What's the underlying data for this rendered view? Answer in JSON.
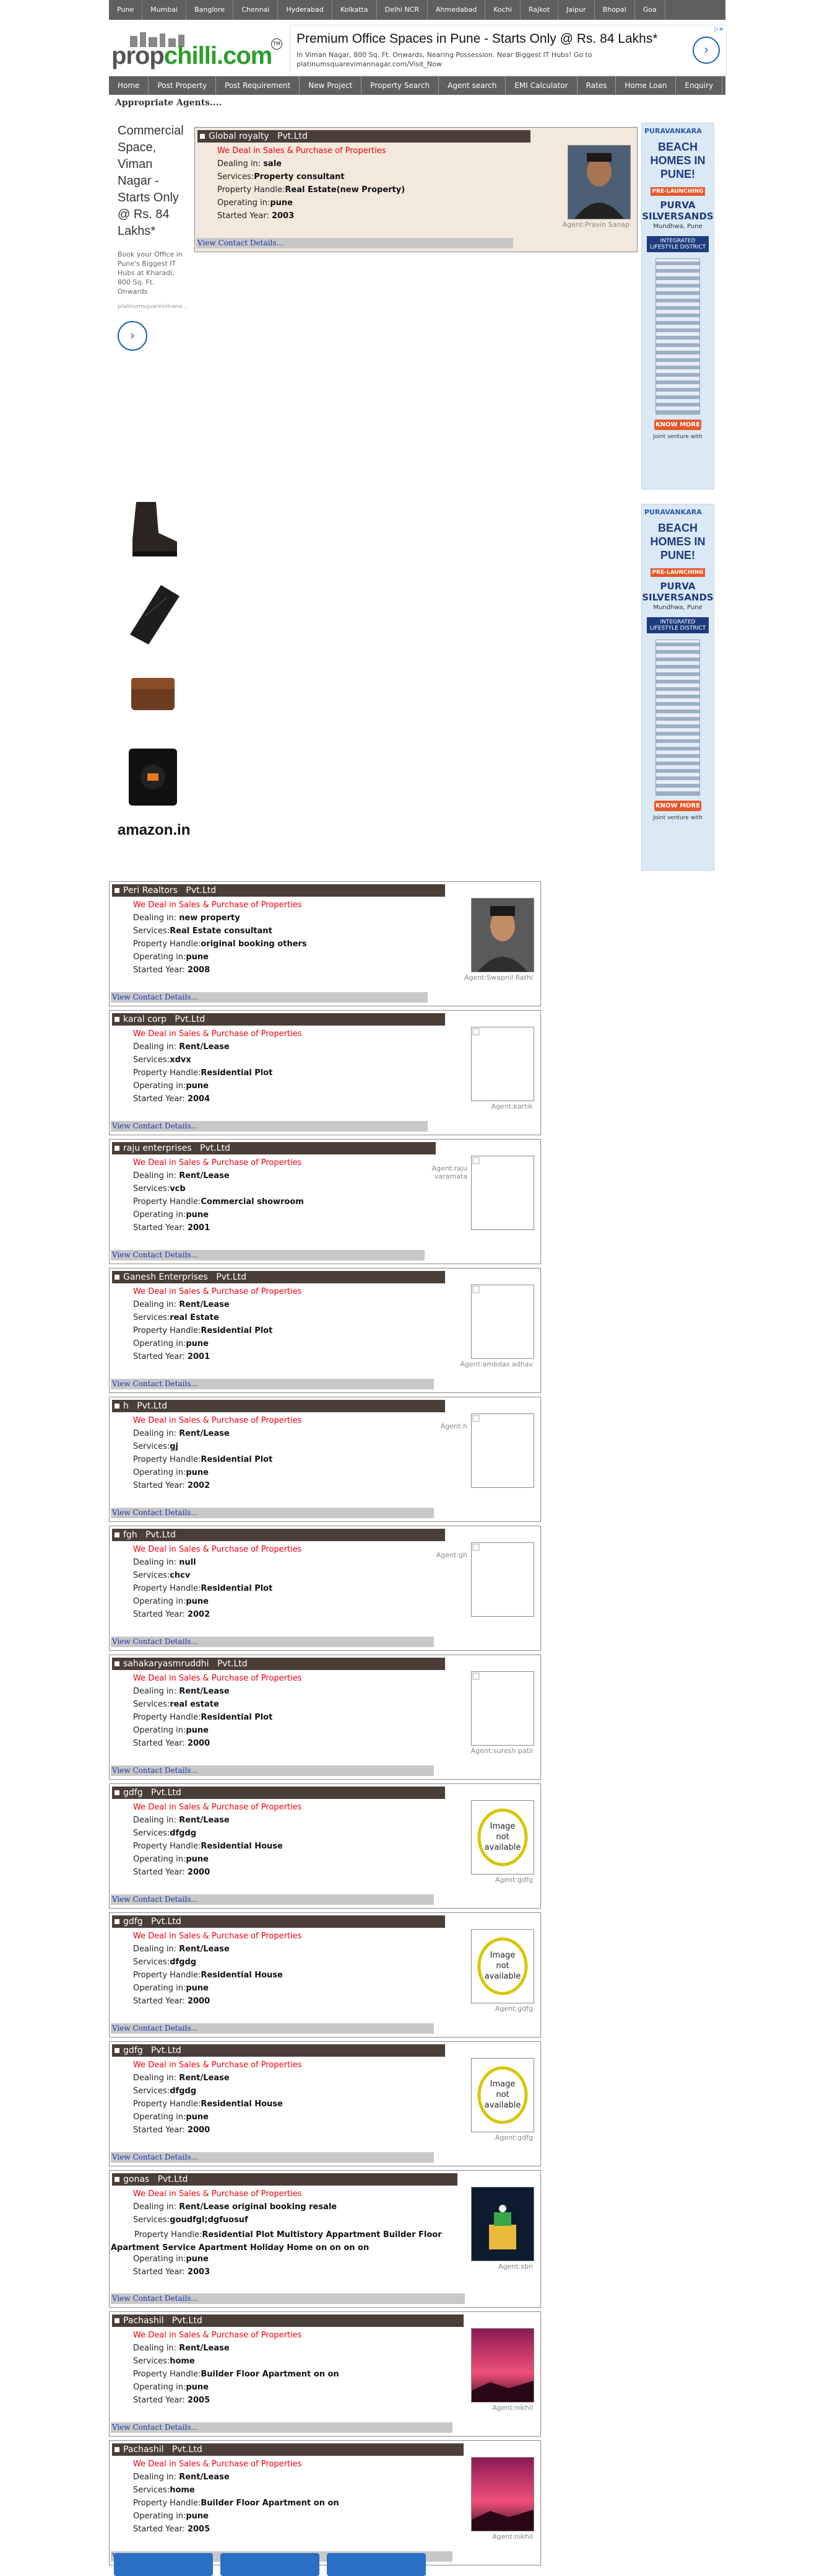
{
  "city_nav": [
    "Pune",
    "Mumbai",
    "Banglore",
    "Chennai",
    "Hyderabad",
    "Kolkatta",
    "Delhi NCR",
    "Ahmedabad",
    "Kochi",
    "Rajkot",
    "Jaipur",
    "Bhopal",
    "Goa"
  ],
  "logo": {
    "part1": "prop",
    "part2": "chilli",
    "part3": ".com",
    "tm": "TM"
  },
  "top_ad": {
    "headline": "Premium Office Spaces in Pune - Starts Only @ Rs. 84 Lakhs*",
    "text": "In Viman Nagar, 800 Sq. Ft. Onwards, Nearing Possession. Near Biggest IT Hubs! Go to",
    "url": "platinumsquarevimannagar.com/Visit_Now",
    "arrow": "›"
  },
  "main_nav": [
    "Home",
    "Post Property",
    "Post Requirement",
    "New Project",
    "Property Search",
    "Agent search",
    "EMI Calculator",
    "Rates",
    "Home Loan",
    "Enquiry"
  ],
  "page_heading": "Appropriate Agents....",
  "left_ad": {
    "big": "Commercial Space, Viman Nagar - Starts Only @ Rs. 84 Lakhs*",
    "small": "Book your Office in Pune's Biggest IT Hubs at Kharadi, 800 Sq. Ft. Onwards",
    "url": "platinumsquarevimana...",
    "arrow": "›"
  },
  "amazon_label": "amazon.in",
  "right_ad": {
    "brand": "PURAVANKARA",
    "headline": "BEACH HOMES IN PUNE!",
    "tag": "PRE-LAUNCHING",
    "project": "PURVA SILVERSANDS",
    "location": "Mundhwa, Pune",
    "sub": "INTEGRATED LIFESTYLE DISTRICT",
    "know": "KNOW MORE",
    "jv": "Joint venture with"
  },
  "labels": {
    "tagline": "We Deal in Sales & Purchase of Properties",
    "dealing": "Dealing in: ",
    "services": "Services:",
    "handle": "Property Handle:",
    "operating": "Operating in:",
    "started": "Started Year: ",
    "view": "View Contact Details...",
    "pvt": "Pvt.Ltd",
    "not_available": "Image not available"
  },
  "agents": [
    {
      "company": "Global royalty",
      "dealing": "sale",
      "services": "Property consultant",
      "handle": "Real Estate(new Property)",
      "operating": "pune",
      "year": "2003",
      "agent": "Agent:Pravin Sanap"
    },
    {
      "company": "Peri Realtors",
      "dealing": "new property",
      "services": "Real Estate consultant",
      "handle": "original booking others",
      "operating": "pune",
      "year": "2008",
      "agent": "Agent:Swapnil Rathi"
    },
    {
      "company": "karal corp",
      "dealing": "Rent/Lease",
      "services": "xdvx",
      "handle": "Residential Plot",
      "operating": "pune",
      "year": "2004",
      "agent": "Agent:kartik"
    },
    {
      "company": "raju enterprises",
      "dealing": "Rent/Lease",
      "services": "vcb",
      "handle": "Commercial showroom",
      "operating": "pune",
      "year": "2001",
      "agent": "Agent:raju varamata"
    },
    {
      "company": "Ganesh Enterprises",
      "dealing": "Rent/Lease",
      "services": "real Estate",
      "handle": "Residential Plot",
      "operating": "pune",
      "year": "2001",
      "agent": "Agent:ambdas adhav"
    },
    {
      "company": "h",
      "dealing": "Rent/Lease",
      "services": "gj",
      "handle": "Residential Plot",
      "operating": "pune",
      "year": "2002",
      "agent": "Agent:h"
    },
    {
      "company": "fgh",
      "dealing": "null",
      "services": "chcv",
      "handle": "Residential Plot",
      "operating": "pune",
      "year": "2002",
      "agent": "Agent:gh"
    },
    {
      "company": "sahakaryasmruddhi",
      "dealing": "Rent/Lease",
      "services": "real estate",
      "handle": "Residential Plot",
      "operating": "pune",
      "year": "2000",
      "agent": "Agent:suresh patil"
    },
    {
      "company": "gdfg",
      "dealing": "Rent/Lease",
      "services": "dfgdg",
      "handle": "Residential House",
      "operating": "pune",
      "year": "2000",
      "agent": "Agent:gdfg"
    },
    {
      "company": "gdfg",
      "dealing": "Rent/Lease",
      "services": "dfgdg",
      "handle": "Residential House",
      "operating": "pune",
      "year": "2000",
      "agent": "Agent:gdfg"
    },
    {
      "company": "gdfg",
      "dealing": "Rent/Lease",
      "services": "dfgdg",
      "handle": "Residential House",
      "operating": "pune",
      "year": "2000",
      "agent": "Agent:gdfg"
    },
    {
      "company": "gonas",
      "dealing": "Rent/Lease original booking resale",
      "services": "goudfgl;dgfuosuf",
      "handle": "Residential Plot Multistory Appartment Builder Floor Apartment Service Apartment Holiday Home on on on on",
      "operating": "pune",
      "year": "2003",
      "agent": "Agent:sbn"
    },
    {
      "company": "Pachashil",
      "dealing": "Rent/Lease",
      "services": "home",
      "handle": "Builder Floor Apartment on on",
      "operating": "pune",
      "year": "2005",
      "agent": "Agent:nikhil"
    },
    {
      "company": "Pachashil",
      "dealing": "Rent/Lease",
      "services": "home",
      "handle": "Builder Floor Apartment on on",
      "operating": "pune",
      "year": "2005",
      "agent": "Agent:nikhil"
    }
  ]
}
